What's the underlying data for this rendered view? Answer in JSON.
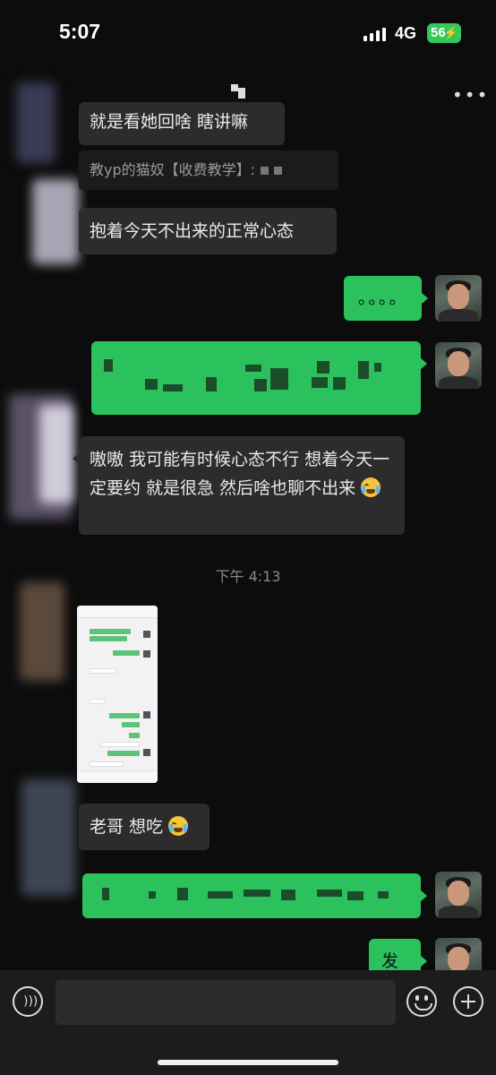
{
  "status_bar": {
    "time": "5:07",
    "network": "4G",
    "battery": "56"
  },
  "header": {
    "more_icon": "more-dots-icon"
  },
  "messages": {
    "m1": "就是看她回啥 瞎讲嘛",
    "quote": "教yp的猫奴【收费教学】:",
    "m2": "抱着今天不出来的正常心态",
    "m3": "。。。。",
    "m5": "嗷嗷 我可能有时候心态不行 想着今天一定要约 就是很急 然后啥也聊不出来",
    "timestamp": "下午 4:13",
    "m7": "老哥 想吃",
    "m9": "发"
  },
  "colors": {
    "bubble_out": "#2bc25d",
    "bubble_in": "#2c2c2c",
    "background": "#0c0c0c"
  },
  "input_bar": {
    "voice_icon": "voice-icon",
    "emoji_icon": "emoji-icon",
    "plus_icon": "plus-icon"
  }
}
